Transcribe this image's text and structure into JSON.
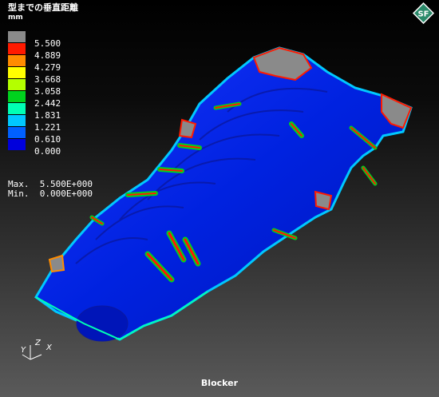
{
  "header": {
    "title": "型までの垂直距離",
    "unit": "mm"
  },
  "legend": {
    "values": [
      "5.500",
      "4.889",
      "4.279",
      "3.668",
      "3.058",
      "2.442",
      "1.831",
      "1.221",
      "0.610",
      "0.000"
    ],
    "colors": [
      "#8a8a8a",
      "#ff1a00",
      "#ff8c00",
      "#ffff00",
      "#b4ff00",
      "#00d21e",
      "#00ffb4",
      "#00c8ff",
      "#0060ff",
      "#0000dc"
    ]
  },
  "stats": {
    "max_label": "Max.",
    "max_value": "5.500E+000",
    "min_label": "Min.",
    "min_value": "0.000E+000"
  },
  "logo": {
    "text": "SF",
    "icon": "diamond-logo-icon"
  },
  "axes": {
    "x": "X",
    "y": "Y",
    "z": "Z"
  },
  "footer": {
    "label": "Blocker"
  }
}
